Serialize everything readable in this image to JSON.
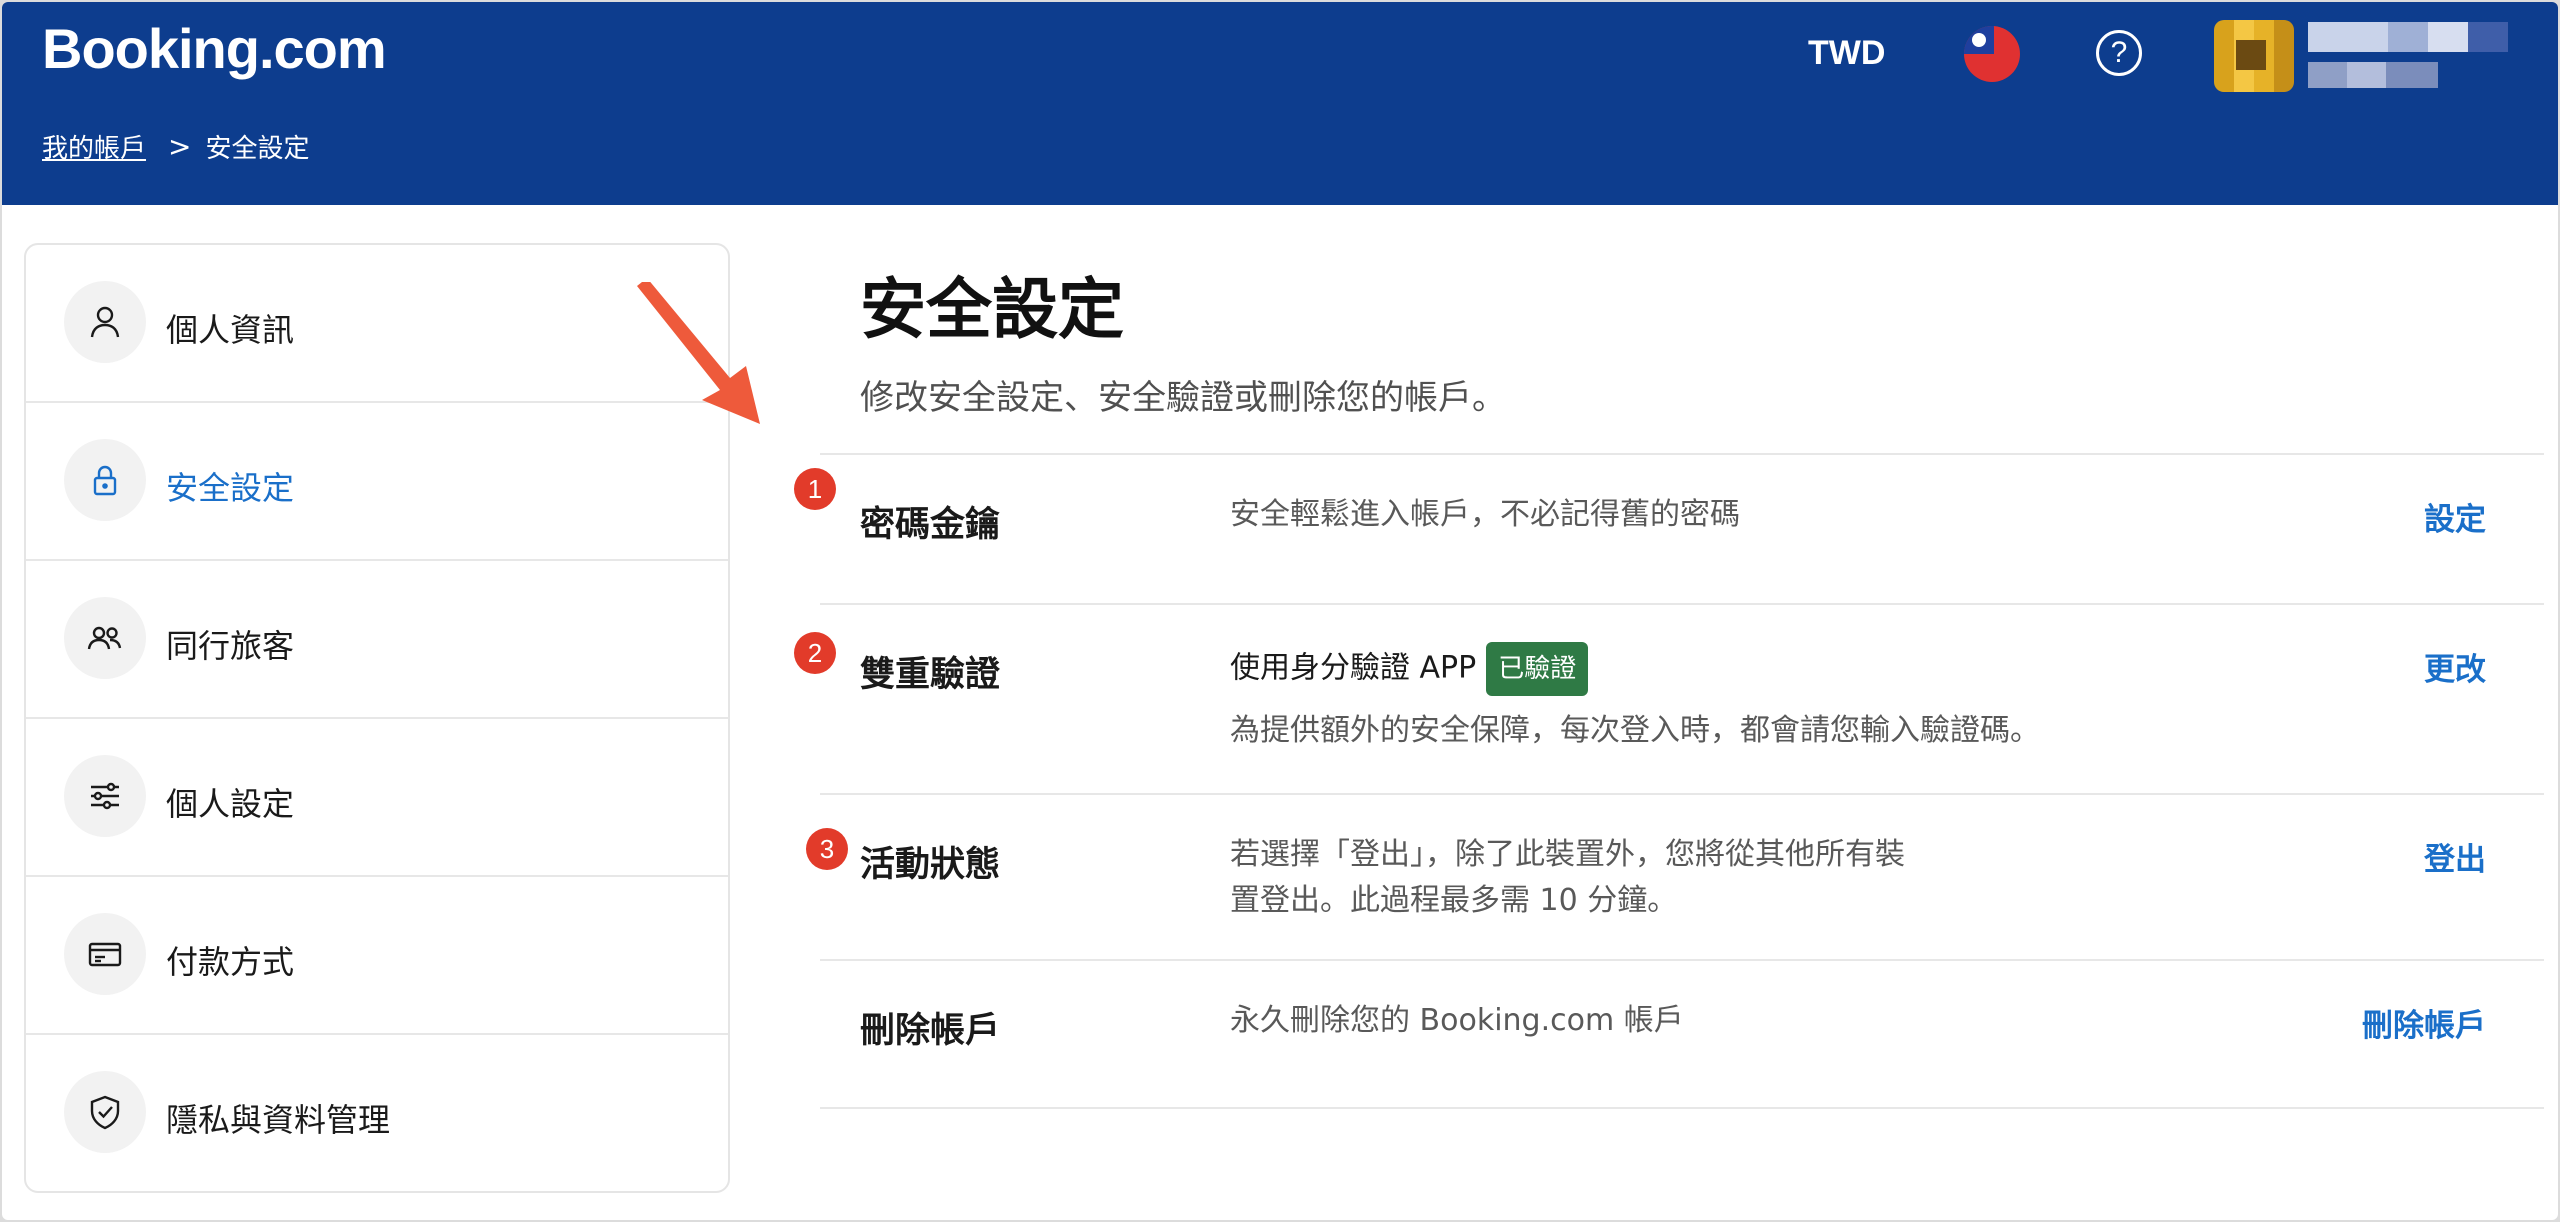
{
  "header": {
    "logo": "Booking.com",
    "currency": "TWD",
    "help_symbol": "?",
    "flag": "taiwan-flag-icon",
    "colors": {
      "background": "#0d3d8e",
      "text": "#ffffff"
    }
  },
  "breadcrumb": {
    "parent": "我的帳戶",
    "separator": ">",
    "current": "安全設定"
  },
  "sidebar": {
    "items": [
      {
        "label": "個人資訊",
        "icon": "person-icon",
        "active": false
      },
      {
        "label": "安全設定",
        "icon": "lock-icon",
        "active": true
      },
      {
        "label": "同行旅客",
        "icon": "people-icon",
        "active": false
      },
      {
        "label": "個人設定",
        "icon": "sliders-icon",
        "active": false
      },
      {
        "label": "付款方式",
        "icon": "credit-card-icon",
        "active": false
      },
      {
        "label": "隱私與資料管理",
        "icon": "shield-check-icon",
        "active": false
      }
    ],
    "active_color": "#1a6fc9"
  },
  "main": {
    "title": "安全設定",
    "subtitle": "修改安全設定、安全驗證或刪除您的帳戶。",
    "rows": [
      {
        "marker": "1",
        "title": "密碼金鑰",
        "description": "安全輕鬆進入帳戶，不必記得舊的密碼",
        "action": "設定"
      },
      {
        "marker": "2",
        "title": "雙重驗證",
        "description_primary": "使用身分驗證 APP",
        "badge": "已驗證",
        "description": "為提供額外的安全保障，每次登入時，都會請您輸入驗證碼。",
        "action": "更改"
      },
      {
        "marker": "3",
        "title": "活動狀態",
        "description_line1": "若選擇「登出」，除了此裝置外，您將從其他所有裝",
        "description_line2": "置登出。此過程最多需 10 分鐘。",
        "action": "登出"
      },
      {
        "title": "刪除帳戶",
        "description": "永久刪除您的 Booking.com 帳戶",
        "action": "刪除帳戶"
      }
    ],
    "annotation_color": "#e23b2a",
    "verified_color": "#2f7a45"
  }
}
